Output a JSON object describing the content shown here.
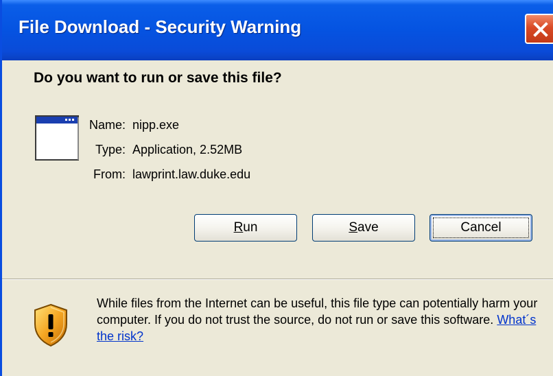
{
  "window": {
    "title": "File Download - Security Warning"
  },
  "dialog": {
    "question": "Do you want to run or save this file?",
    "file": {
      "name_label": "Name:",
      "name_value": "nipp.exe",
      "type_label": "Type:",
      "type_value": "Application, 2.52MB",
      "from_label": "From:",
      "from_value": "lawprint.law.duke.edu"
    },
    "buttons": {
      "run_access": "R",
      "run_rest": "un",
      "save_access": "S",
      "save_rest": "ave",
      "cancel": "Cancel"
    },
    "warning": {
      "text": "While files from the Internet can be useful, this file type can potentially harm your computer. If you do not trust the source, do not run or save this software. ",
      "link": "What´s the risk?"
    }
  },
  "icons": {
    "file": "application-window-icon",
    "warning": "security-shield-warning-icon",
    "close": "close-icon"
  },
  "colors": {
    "titlebar": "#0553e1",
    "dialog_background": "#ece9d8",
    "close_button": "#d94a26",
    "link": "#0033cc"
  }
}
